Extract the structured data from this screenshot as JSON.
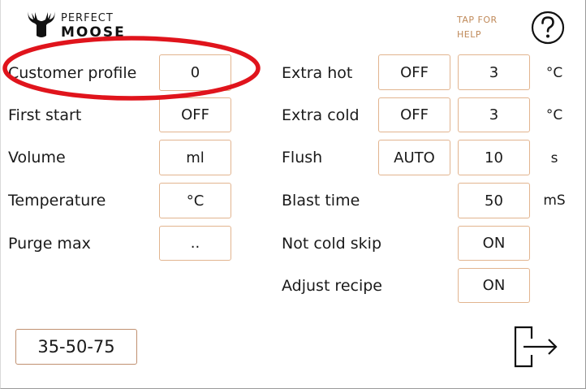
{
  "logo": {
    "line1": "PERFECT",
    "line2": "MOOSE",
    "icon": "moose-head-icon"
  },
  "help": {
    "tap_text_line1": "TAP FOR",
    "tap_text_line2": "HELP",
    "icon": "question-circle-icon"
  },
  "left_settings": [
    {
      "label": "Customer  profile",
      "value": "0"
    },
    {
      "label": "First start",
      "value": "OFF"
    },
    {
      "label": "Volume",
      "value": "ml"
    },
    {
      "label": "Temperature",
      "value": "°C"
    },
    {
      "label": "Purge max",
      "value": ".."
    }
  ],
  "right_settings": {
    "extra_hot": {
      "label": "Extra hot",
      "mode": "OFF",
      "value": "3",
      "unit": "°C"
    },
    "extra_cold": {
      "label": "Extra cold",
      "mode": "OFF",
      "value": "3",
      "unit": "°C"
    },
    "flush": {
      "label": "Flush",
      "mode": "AUTO",
      "value": "10",
      "unit": "s"
    },
    "blast_time": {
      "label": "Blast time",
      "value": "50",
      "unit": "mS"
    },
    "not_cold_skip": {
      "label": "Not cold skip",
      "value": "ON"
    },
    "adjust_recipe": {
      "label": "Adjust recipe",
      "value": "ON"
    }
  },
  "preset_button": {
    "label": "35-50-75"
  },
  "exit_button": {
    "icon": "exit-icon"
  },
  "colors": {
    "field_border": "#e2b48f",
    "annotation": "#e0141c",
    "help_text": "#c08a5a"
  }
}
